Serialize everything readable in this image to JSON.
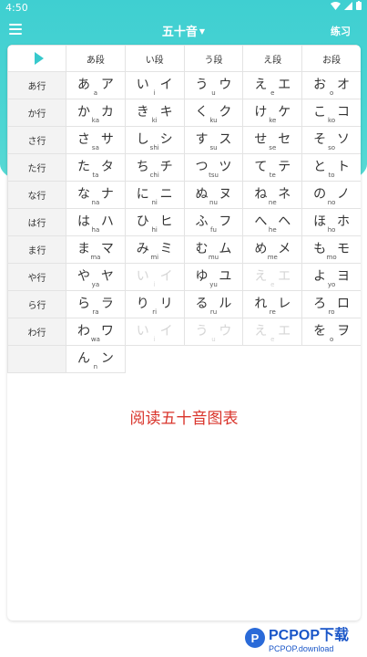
{
  "status": {
    "time": "4:50"
  },
  "topbar": {
    "title": "五十音",
    "practice_label": "练习"
  },
  "columns": [
    "あ段",
    "い段",
    "う段",
    "え段",
    "お段"
  ],
  "rows": [
    {
      "label": "あ行",
      "cells": [
        {
          "h": "あ",
          "k": "ア",
          "r": "a"
        },
        {
          "h": "い",
          "k": "イ",
          "r": "i"
        },
        {
          "h": "う",
          "k": "ウ",
          "r": "u"
        },
        {
          "h": "え",
          "k": "エ",
          "r": "e"
        },
        {
          "h": "お",
          "k": "オ",
          "r": "o"
        }
      ]
    },
    {
      "label": "か行",
      "cells": [
        {
          "h": "か",
          "k": "カ",
          "r": "ka"
        },
        {
          "h": "き",
          "k": "キ",
          "r": "ki"
        },
        {
          "h": "く",
          "k": "ク",
          "r": "ku"
        },
        {
          "h": "け",
          "k": "ケ",
          "r": "ke"
        },
        {
          "h": "こ",
          "k": "コ",
          "r": "ko"
        }
      ]
    },
    {
      "label": "さ行",
      "cells": [
        {
          "h": "さ",
          "k": "サ",
          "r": "sa"
        },
        {
          "h": "し",
          "k": "シ",
          "r": "shi"
        },
        {
          "h": "す",
          "k": "ス",
          "r": "su"
        },
        {
          "h": "せ",
          "k": "セ",
          "r": "se"
        },
        {
          "h": "そ",
          "k": "ソ",
          "r": "so"
        }
      ]
    },
    {
      "label": "た行",
      "cells": [
        {
          "h": "た",
          "k": "タ",
          "r": "ta"
        },
        {
          "h": "ち",
          "k": "チ",
          "r": "chi"
        },
        {
          "h": "つ",
          "k": "ツ",
          "r": "tsu"
        },
        {
          "h": "て",
          "k": "テ",
          "r": "te"
        },
        {
          "h": "と",
          "k": "ト",
          "r": "to"
        }
      ]
    },
    {
      "label": "な行",
      "cells": [
        {
          "h": "な",
          "k": "ナ",
          "r": "na"
        },
        {
          "h": "に",
          "k": "ニ",
          "r": "ni"
        },
        {
          "h": "ぬ",
          "k": "ヌ",
          "r": "nu"
        },
        {
          "h": "ね",
          "k": "ネ",
          "r": "ne"
        },
        {
          "h": "の",
          "k": "ノ",
          "r": "no"
        }
      ]
    },
    {
      "label": "は行",
      "cells": [
        {
          "h": "は",
          "k": "ハ",
          "r": "ha"
        },
        {
          "h": "ひ",
          "k": "ヒ",
          "r": "hi"
        },
        {
          "h": "ふ",
          "k": "フ",
          "r": "fu"
        },
        {
          "h": "へ",
          "k": "ヘ",
          "r": "he"
        },
        {
          "h": "ほ",
          "k": "ホ",
          "r": "ho"
        }
      ]
    },
    {
      "label": "ま行",
      "cells": [
        {
          "h": "ま",
          "k": "マ",
          "r": "ma"
        },
        {
          "h": "み",
          "k": "ミ",
          "r": "mi"
        },
        {
          "h": "む",
          "k": "ム",
          "r": "mu"
        },
        {
          "h": "め",
          "k": "メ",
          "r": "me"
        },
        {
          "h": "も",
          "k": "モ",
          "r": "mo"
        }
      ]
    },
    {
      "label": "や行",
      "cells": [
        {
          "h": "や",
          "k": "ヤ",
          "r": "ya"
        },
        {
          "h": "い",
          "k": "イ",
          "r": "i",
          "empty": true
        },
        {
          "h": "ゆ",
          "k": "ユ",
          "r": "yu"
        },
        {
          "h": "え",
          "k": "エ",
          "r": "e",
          "empty": true
        },
        {
          "h": "よ",
          "k": "ヨ",
          "r": "yo"
        }
      ]
    },
    {
      "label": "ら行",
      "cells": [
        {
          "h": "ら",
          "k": "ラ",
          "r": "ra"
        },
        {
          "h": "り",
          "k": "リ",
          "r": "ri"
        },
        {
          "h": "る",
          "k": "ル",
          "r": "ru"
        },
        {
          "h": "れ",
          "k": "レ",
          "r": "re"
        },
        {
          "h": "ろ",
          "k": "ロ",
          "r": "ro"
        }
      ]
    },
    {
      "label": "わ行",
      "cells": [
        {
          "h": "わ",
          "k": "ワ",
          "r": "wa"
        },
        {
          "h": "い",
          "k": "イ",
          "r": "i",
          "empty": true
        },
        {
          "h": "う",
          "k": "ウ",
          "r": "u",
          "empty": true
        },
        {
          "h": "え",
          "k": "エ",
          "r": "e",
          "empty": true
        },
        {
          "h": "を",
          "k": "ヲ",
          "r": "o"
        }
      ]
    }
  ],
  "n_cell": {
    "h": "ん",
    "k": "ン",
    "r": "n"
  },
  "read_button": "阅读五十音图表",
  "watermark": {
    "brand": "PCPOP下载",
    "sub": "PCPOP.download"
  },
  "colors": {
    "accent": "#3fcfd1",
    "read_button": "#d9342b"
  }
}
